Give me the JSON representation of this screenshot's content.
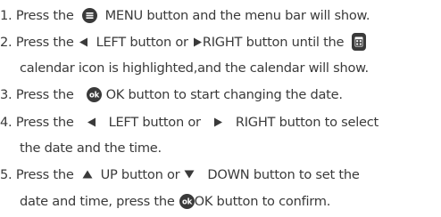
{
  "instructions": {
    "step1": {
      "prefix": "1. Press the",
      "suffix": "MENU button and the menu bar will show."
    },
    "step2": {
      "prefix": "2. Press the",
      "left_label": "LEFT button or",
      "right_label": "RIGHT button until the",
      "line2": "calendar icon is highlighted,and the calendar will show."
    },
    "step3": {
      "prefix": "3. Press the",
      "suffix": "OK button to start changing the date."
    },
    "step4": {
      "prefix": "4. Press the",
      "left_label": "LEFT button or",
      "right_label": "RIGHT button to select",
      "line2": "the date and the time."
    },
    "step5": {
      "prefix": "5. Press the",
      "up_label": "UP button or",
      "down_label": "DOWN button to set the",
      "line2a": "date and time, press the",
      "line2b": "OK button to confirm."
    }
  },
  "icons": {
    "menu": "menu-icon",
    "left": "left-arrow-icon",
    "right": "right-arrow-icon",
    "calendar": "calendar-icon",
    "ok": "ok-icon",
    "up": "up-arrow-icon",
    "down": "down-arrow-icon"
  },
  "colors": {
    "text": "#3a3a3a",
    "icon": "#3a3a3a",
    "icon_inner": "#ffffff"
  }
}
